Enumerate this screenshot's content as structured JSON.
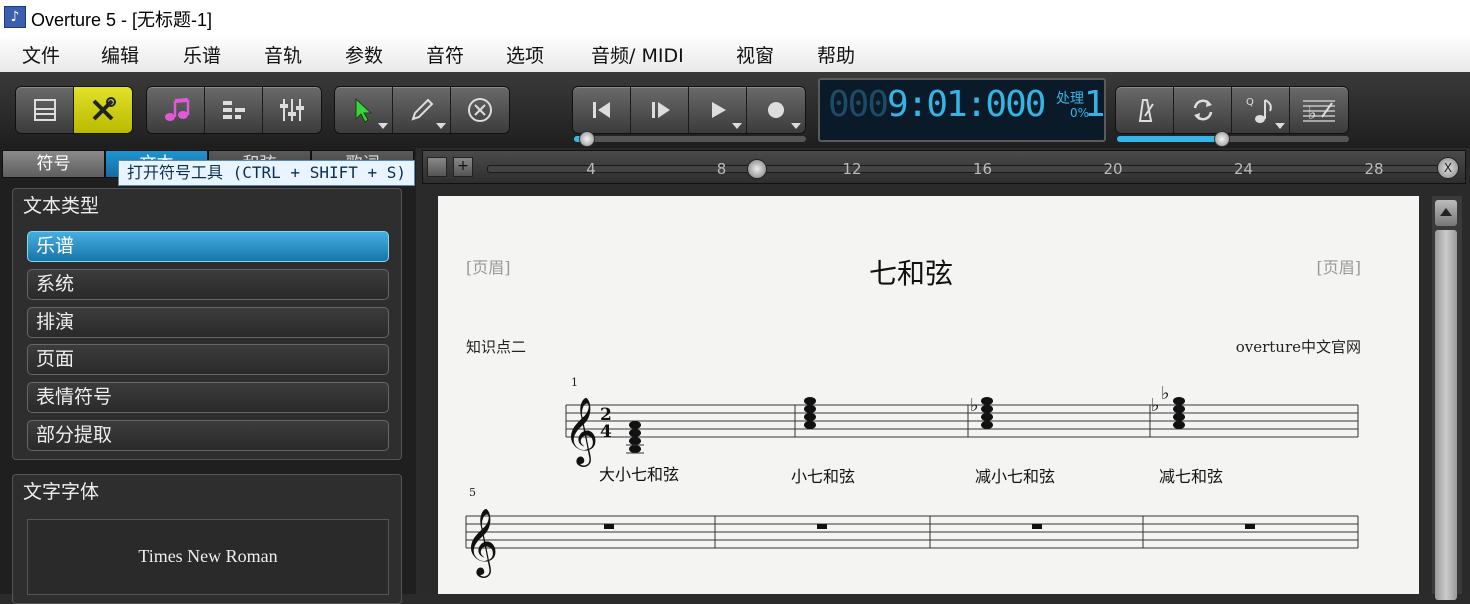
{
  "window": {
    "title": "Overture 5 - [无标题-1]",
    "app_icon": "overture-app-icon"
  },
  "menu": [
    "文件",
    "编辑",
    "乐谱",
    "音轨",
    "参数",
    "音符",
    "选项",
    "音频/ MIDI",
    "视窗",
    "帮助"
  ],
  "toolbar": {
    "groups": [
      {
        "name": "view",
        "buttons": [
          "page-view-icon",
          "tools-icon"
        ]
      },
      {
        "name": "windows",
        "buttons": [
          "notes-icon",
          "track-list-icon",
          "mixer-icon"
        ]
      },
      {
        "name": "edit",
        "buttons": [
          "select-arrow-icon",
          "pencil-icon",
          "erase-icon"
        ]
      },
      {
        "name": "transport",
        "buttons": [
          "rewind-icon",
          "step-forward-icon",
          "play-icon",
          "record-icon"
        ]
      },
      {
        "name": "options",
        "buttons": [
          "metronome-icon",
          "loop-icon",
          "quantize-icon",
          "score-options-icon"
        ]
      }
    ],
    "tools_active": true,
    "counter": {
      "dim_prefix": "000",
      "value": "9:01:000",
      "beat": "1",
      "status": "处理",
      "percent": "0%"
    },
    "transport_position": 0.05,
    "tempo_level": 0.45
  },
  "left_panel": {
    "tabs": [
      "符号",
      "文本",
      "和弦",
      "歌词"
    ],
    "active_tab_index": 0,
    "selected_tab_index": 1,
    "tooltip": "打开符号工具 (CTRL + SHIFT + S)",
    "text_type": {
      "title": "文本类型",
      "items": [
        "乐谱",
        "系统",
        "排演",
        "页面",
        "表情符号",
        "部分提取"
      ],
      "selected_index": 0
    },
    "font": {
      "title": "文字字体",
      "name": "Times New Roman"
    }
  },
  "ruler": {
    "marks": [
      "4",
      "8",
      "12",
      "16",
      "20",
      "24",
      "28"
    ],
    "position": 0.28,
    "add_button": "+",
    "close_button": "X"
  },
  "score": {
    "header_left": "[页眉]",
    "header_right": "[页眉]",
    "title": "七和弦",
    "subtitle": "知识点二",
    "composer": "overture中文官网",
    "time_signature": "2/4",
    "system1_measure": "1",
    "system2_measure": "5",
    "chord_labels": [
      "大小七和弦",
      "小七和弦",
      "减小七和弦",
      "减七和弦"
    ]
  },
  "colors": {
    "accent": "#38b6e8",
    "selection": "#1f95d0",
    "tool_active": "#e2e22a"
  }
}
